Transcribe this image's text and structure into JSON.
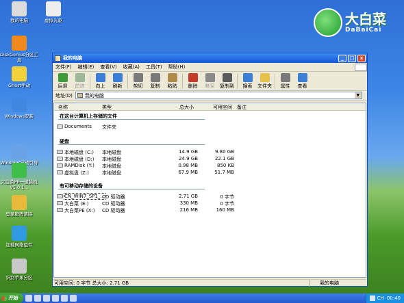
{
  "desktop": {
    "icons": [
      {
        "label": "我的电脑",
        "icon": "computer-icon",
        "color": "#dcdcdc"
      },
      {
        "label": "虚拟光驱",
        "icon": "disc-icon",
        "color": "#eeeeee"
      },
      {
        "label": "DiskGenius分区工具",
        "icon": "diskgenius-icon",
        "color": "#f08a1c"
      },
      {
        "label": "Ghost手动",
        "icon": "ghost-icon",
        "color": "#f2d23a"
      },
      {
        "label": "Windows安装",
        "icon": "windows-install-icon",
        "color": "#3f87e0"
      },
      {
        "label": "Windows启动引导修复",
        "icon": "boot-repair-icon",
        "color": "#6aa2e8"
      },
      {
        "label": "大白菜PE一键装机 V5.0.1...",
        "icon": "dabaicai-install-icon",
        "color": "#3fbf4a"
      },
      {
        "label": "登录密码清除",
        "icon": "key-icon",
        "color": "#e9b93a"
      },
      {
        "label": "加载网络组件",
        "icon": "network-icon",
        "color": "#2f9ae0"
      },
      {
        "label": "识别苹果分区",
        "icon": "apple-partition-icon",
        "color": "#c9c9c9"
      }
    ],
    "logo": {
      "cn": "大白菜",
      "en": "DaBaiCai"
    }
  },
  "window": {
    "title": "我的电脑",
    "menu": [
      "文件(F)",
      "编辑(E)",
      "查看(V)",
      "收藏(A)",
      "工具(T)",
      "帮助(H)"
    ],
    "toolbar": [
      {
        "label": "后退",
        "icon": "back-arrow-icon",
        "color": "#3f9b3a",
        "enabled": true
      },
      {
        "label": "前进",
        "icon": "forward-arrow-icon",
        "color": "#9db79a",
        "enabled": false
      },
      {
        "label": "向上",
        "icon": "up-arrow-icon",
        "color": "#3a7ed8",
        "enabled": true
      },
      {
        "label": "刷新",
        "icon": "refresh-icon",
        "color": "#3a7ed8",
        "enabled": true
      },
      {
        "label": "剪切",
        "icon": "cut-icon",
        "color": "#7a7a7a",
        "enabled": true
      },
      {
        "label": "复制",
        "icon": "copy-icon",
        "color": "#7a7a7a",
        "enabled": true
      },
      {
        "label": "粘贴",
        "icon": "paste-icon",
        "color": "#b08a4a",
        "enabled": true
      },
      {
        "label": "删除",
        "icon": "delete-icon",
        "color": "#c23b2b",
        "enabled": true
      },
      {
        "label": "移至",
        "icon": "move-to-icon",
        "color": "#8a8a8a",
        "enabled": false
      },
      {
        "label": "复制到",
        "icon": "copy-to-icon",
        "color": "#5a5a5a",
        "enabled": true
      },
      {
        "label": "搜索",
        "icon": "search-icon",
        "color": "#3a7ed8",
        "enabled": true
      },
      {
        "label": "文件夹",
        "icon": "folder-icon",
        "color": "#e6c24a",
        "enabled": true
      },
      {
        "label": "属性",
        "icon": "properties-icon",
        "color": "#7a7a7a",
        "enabled": true
      },
      {
        "label": "查看",
        "icon": "view-icon",
        "color": "#3a7ed8",
        "enabled": true
      }
    ],
    "address": {
      "label": "地址(D)",
      "value": "我的电脑"
    },
    "columns": [
      "名称",
      "类型",
      "总大小",
      "可用空间",
      "备注"
    ],
    "groups": {
      "files": {
        "title": "在这台计算机上存储的文件",
        "rows": [
          {
            "name": "Documents",
            "type": "文件夹",
            "size": "",
            "free": ""
          }
        ]
      },
      "disks": {
        "title": "硬盘",
        "rows": [
          {
            "name": "本地磁盘 (C:)",
            "type": "本地磁盘",
            "size": "14.9 GB",
            "free": "9.80 GB"
          },
          {
            "name": "本地磁盘 (D:)",
            "type": "本地磁盘",
            "size": "24.9 GB",
            "free": "22.1 GB"
          },
          {
            "name": "RAMDisk (Y:)",
            "type": "本地磁盘",
            "size": "0.98 MB",
            "free": "850 KB"
          },
          {
            "name": "虚拟盘 (Z:)",
            "type": "本地磁盘",
            "size": "67.9 MB",
            "free": "51.7 MB"
          }
        ]
      },
      "removable": {
        "title": "有可移动存储的设备",
        "rows": [
          {
            "name": "CN_WIN7_SP1_...",
            "type": "CD 驱动器",
            "size": "2.71 GB",
            "free": "0 字节"
          },
          {
            "name": "大白菜 (E:)",
            "type": "CD 驱动器",
            "size": "330 MB",
            "free": "0 字节"
          },
          {
            "name": "大白菜PE (X:)",
            "type": "CD 驱动器",
            "size": "216 MB",
            "free": "160 MB"
          }
        ]
      }
    },
    "status": {
      "left": "可用空间: 0 字节 总大小: 2.71 GB",
      "right": "我的电脑"
    }
  },
  "taskbar": {
    "start": "开始",
    "time": "00:40",
    "ime": "CH"
  }
}
